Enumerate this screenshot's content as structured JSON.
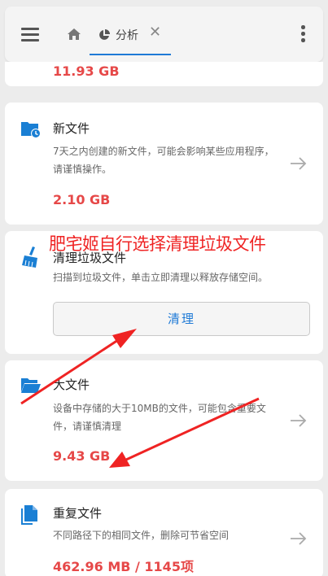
{
  "header": {
    "tab_label": "分析",
    "tab_close": "✕"
  },
  "cards": {
    "prev_size": "11.93 GB",
    "new_files": {
      "title": "新文件",
      "desc": "7天之内创建的新文件，可能会影响某些应用程序，请谨慎操作。",
      "size": "2.10 GB",
      "icon": "folder-clock-icon"
    },
    "junk": {
      "title": "清理垃圾文件",
      "desc": "扫描到垃圾文件，单击立即清理以释放存储空间。",
      "button": "清理",
      "icon": "broom-icon"
    },
    "large": {
      "title": "大文件",
      "desc": "设备中存储的大于10MB的文件，可能包含重要文件，请谨慎清理",
      "size": "9.43 GB",
      "icon": "open-folder-icon"
    },
    "dup": {
      "title": "重复文件",
      "desc": "不同路径下的相同文件，删除可节省空间",
      "size": "462.96 MB / 1145项",
      "icon": "copy-files-icon"
    }
  },
  "annotation": {
    "text": "肥宅姬自行选择清理垃圾文件"
  },
  "colors": {
    "accent": "#1f7ad6",
    "size_red": "#e64848",
    "annotation_red": "#ef2323",
    "icon_blue": "#1a7fd4"
  }
}
